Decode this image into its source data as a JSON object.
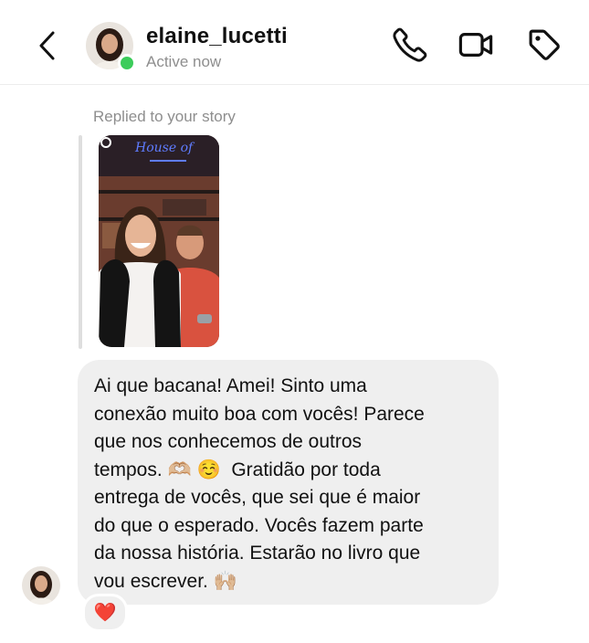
{
  "header": {
    "username": "elaine_lucetti",
    "status": "Active now"
  },
  "thread": {
    "reply_context": "Replied to your story",
    "story_sign_text": "House of",
    "message": "Ai que bacana! Amei! Sinto uma\nconexão muito boa com vocês! Parece\nque nos conhecemos de outros\ntempos. 🫶🏼 ☺️  Gratidão por toda\nentrega de vocês, que sei que é maior\ndo que o esperado. Vocês fazem parte\nda nossa história. Estarão no livro que\nvou escrever. 🙌🏼",
    "reaction": "❤️"
  },
  "colors": {
    "bubble": "#efefef",
    "secondary_text": "#8e8e8e",
    "online": "#3ccc5a",
    "heart": "#e0243a"
  }
}
